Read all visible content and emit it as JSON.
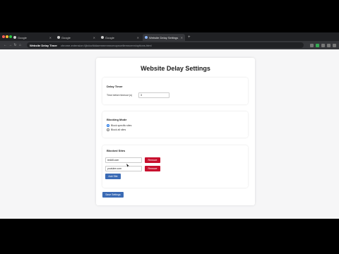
{
  "tabs": [
    {
      "label": "Google",
      "active": false
    },
    {
      "label": "Google",
      "active": false
    },
    {
      "label": "Google",
      "active": false
    },
    {
      "label": "Website Delay Settings",
      "active": true
    }
  ],
  "toolbar": {
    "site_chip": "Website Delay Timer",
    "url": "chrome-extension://jbdocfiddaemmmmncmopnoellemncmm/options.html"
  },
  "page": {
    "title": "Website Delay Settings",
    "delay_timer": {
      "heading": "Delay Timer",
      "label": "Time before timeout (s)",
      "value": "3"
    },
    "blocking_mode": {
      "heading": "Blocking Mode",
      "options": [
        {
          "label": "Block specific sites",
          "selected": true
        },
        {
          "label": "Block all sites",
          "selected": false
        }
      ]
    },
    "blocked_sites": {
      "heading": "Blocked Sites",
      "sites": [
        {
          "value": "reddit.com",
          "remove_label": "Remove"
        },
        {
          "value": "youtube.com",
          "remove_label": "Remove"
        }
      ],
      "add_label": "Add Site"
    },
    "save_label": "Save Settings"
  },
  "colors": {
    "remove_button": "#c8102e",
    "primary_button": "#3b6bb5",
    "radio_selected": "#1a73e8"
  }
}
